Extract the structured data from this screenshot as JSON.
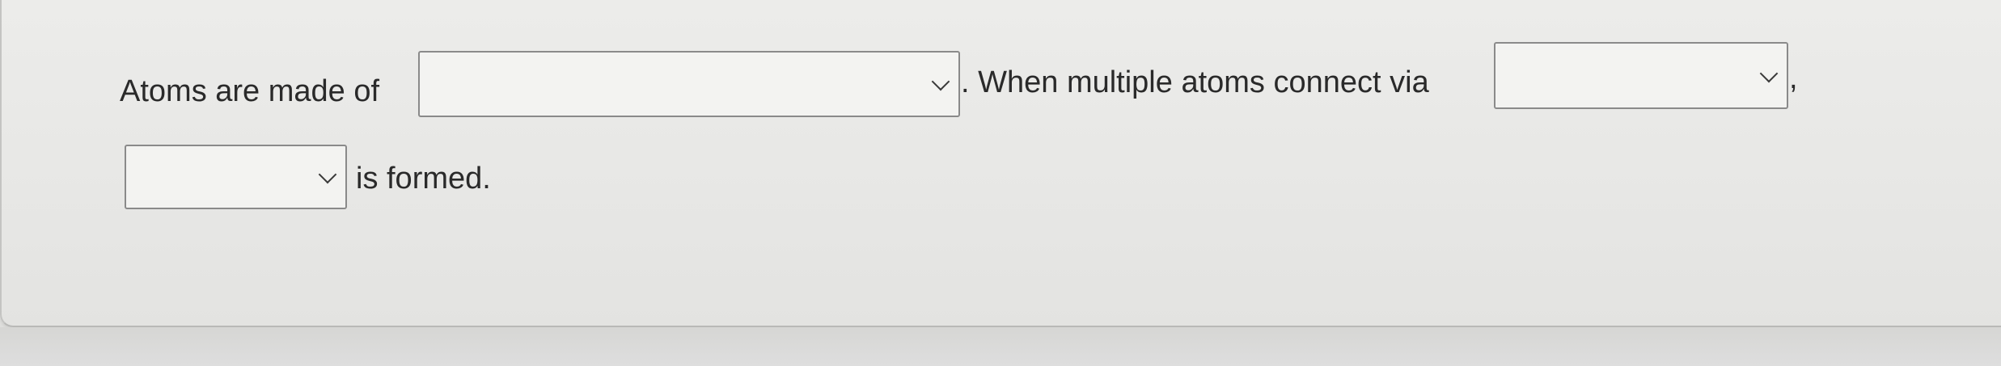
{
  "question": {
    "segment_1": "Atoms are made of",
    "segment_2": ". When multiple atoms connect via",
    "segment_3": ",",
    "segment_4": "is formed."
  },
  "dropdowns": [
    {
      "selected": ""
    },
    {
      "selected": ""
    },
    {
      "selected": ""
    }
  ],
  "icons": {
    "dropdown_arrow": "chevron-down-icon"
  }
}
